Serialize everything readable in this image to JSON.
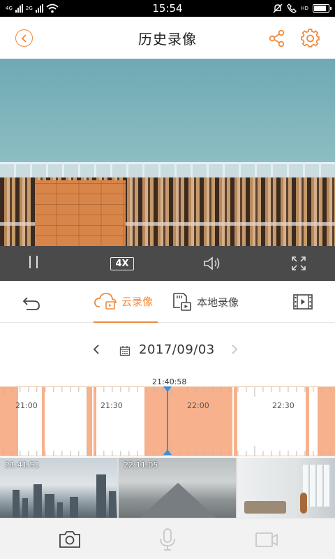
{
  "status_bar": {
    "time": "15:54",
    "network_1": "4G",
    "network_2": "2G",
    "hd": "HD",
    "battery_level": 0.85
  },
  "header": {
    "title": "历史录像"
  },
  "player": {
    "speed_label": "4X"
  },
  "tabs": {
    "cloud_label": "云录像",
    "local_label": "本地录像",
    "active": "cloud"
  },
  "date_selector": {
    "date": "2017/09/03"
  },
  "timeline": {
    "cursor_time": "21:40:58",
    "labels": [
      "21:00",
      "21:30",
      "22:00",
      "22:30"
    ]
  },
  "thumbnails": [
    {
      "time": "21:41:51"
    },
    {
      "time": "22:11:05"
    },
    {
      "time": ""
    }
  ],
  "colors": {
    "accent": "#f08a3c",
    "segment": "#f7b18c",
    "cursor": "#3c8fd6"
  }
}
